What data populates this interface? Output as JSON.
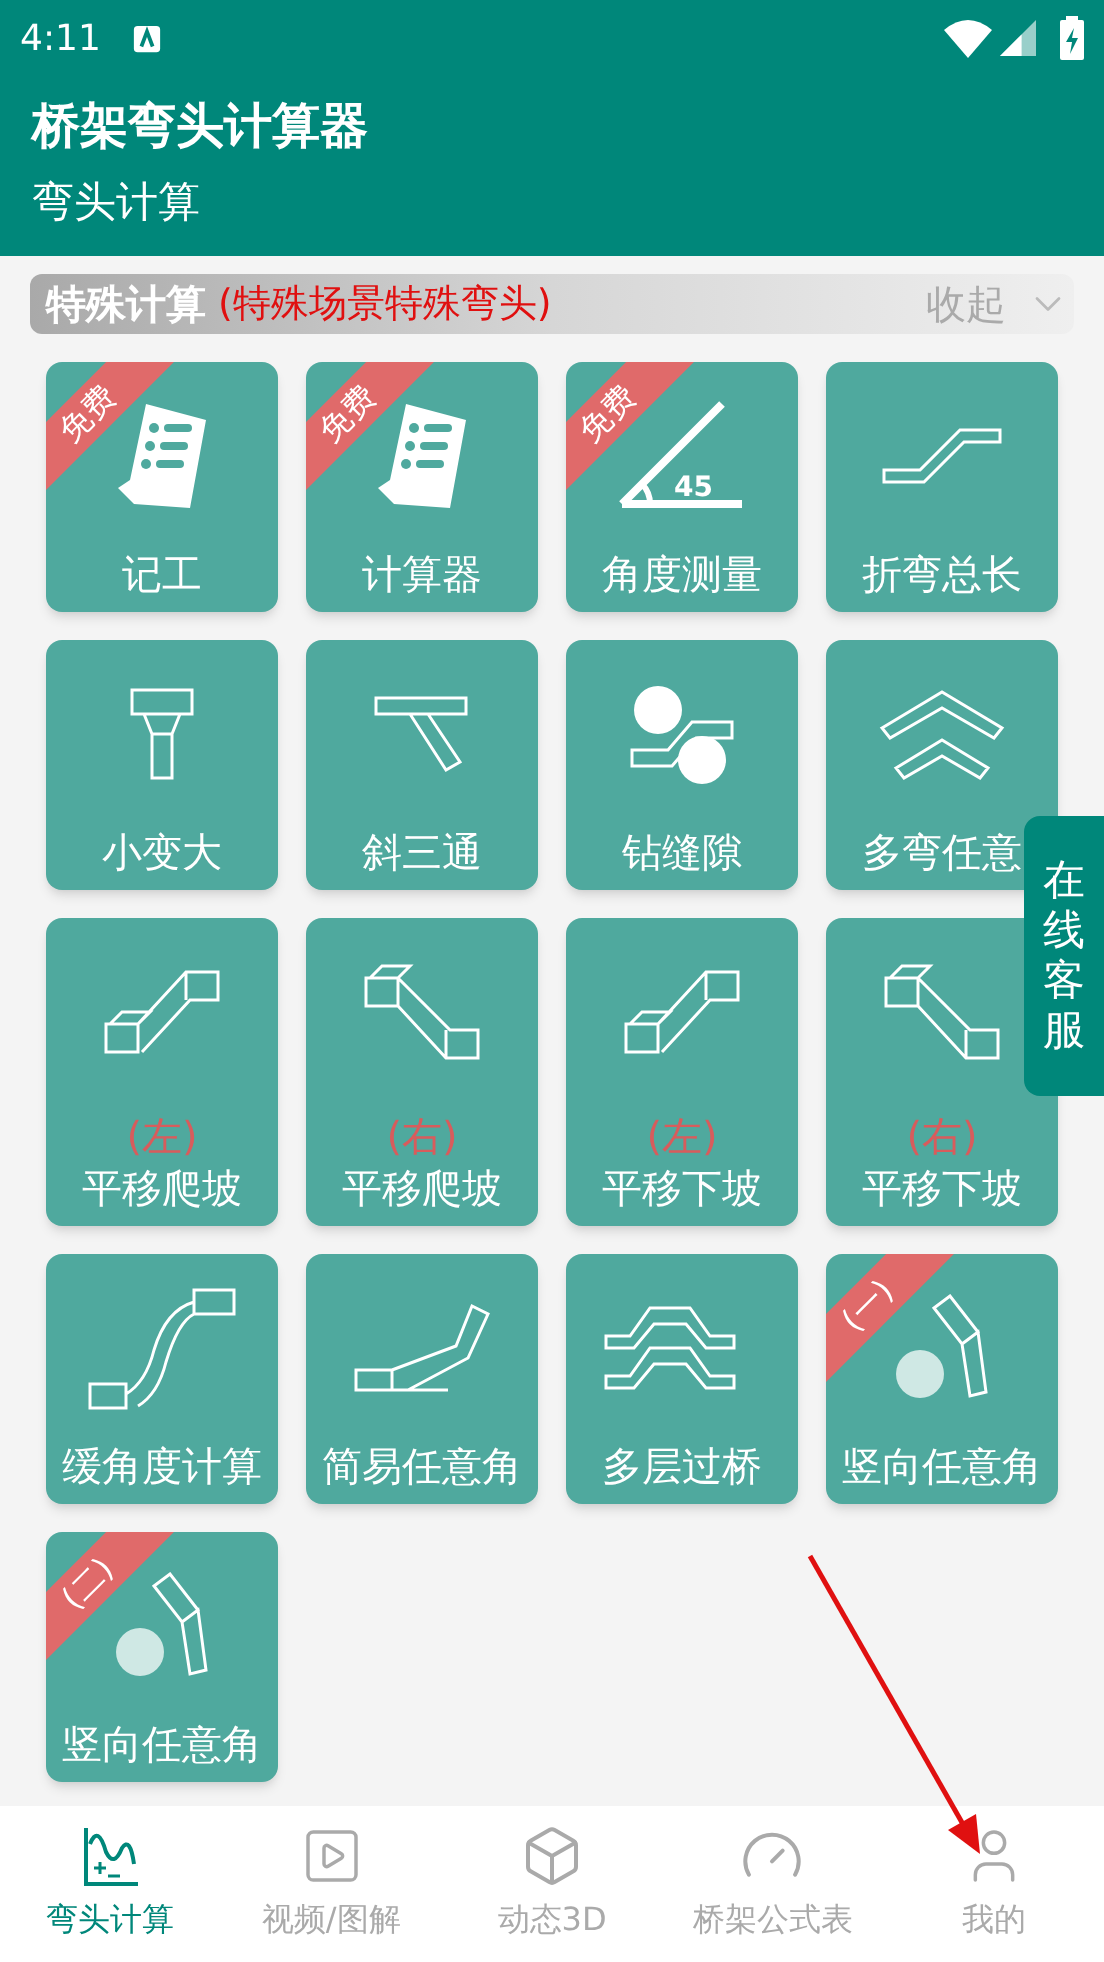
{
  "status_bar": {
    "time": "4:11"
  },
  "header": {
    "title": "桥架弯头计算器",
    "subtitle": "弯头计算"
  },
  "section": {
    "title": "特殊计算",
    "note": "(特殊场景特殊弯头)",
    "toggle": "收起",
    "expanded": true
  },
  "tiles": [
    {
      "label": "记工",
      "badge": "免费"
    },
    {
      "label": "计算器",
      "badge": "免费"
    },
    {
      "label": "角度测量",
      "badge": "免费",
      "icon_text": "45"
    },
    {
      "label": "折弯总长"
    },
    {
      "label": "小变大"
    },
    {
      "label": "斜三通"
    },
    {
      "label": "钻缝隙"
    },
    {
      "label": "多弯任意"
    },
    {
      "label": "平移爬坡",
      "sublabel": "(左)"
    },
    {
      "label": "平移爬坡",
      "sublabel": "(右)"
    },
    {
      "label": "平移下坡",
      "sublabel": "(左)"
    },
    {
      "label": "平移下坡",
      "sublabel": "(右)"
    },
    {
      "label": "缓角度计算"
    },
    {
      "label": "简易任意角"
    },
    {
      "label": "多层过桥"
    },
    {
      "label": "竖向任意角",
      "badge": "(一)"
    },
    {
      "label": "竖向任意角",
      "badge": "(二)"
    }
  ],
  "float_button": {
    "label": "在线客服"
  },
  "nav": [
    {
      "label": "弯头计算",
      "selected": true
    },
    {
      "label": "视频/图解",
      "selected": false
    },
    {
      "label": "动态3D",
      "selected": false
    },
    {
      "label": "桥架公式表",
      "selected": false
    },
    {
      "label": "我的",
      "selected": false
    }
  ]
}
